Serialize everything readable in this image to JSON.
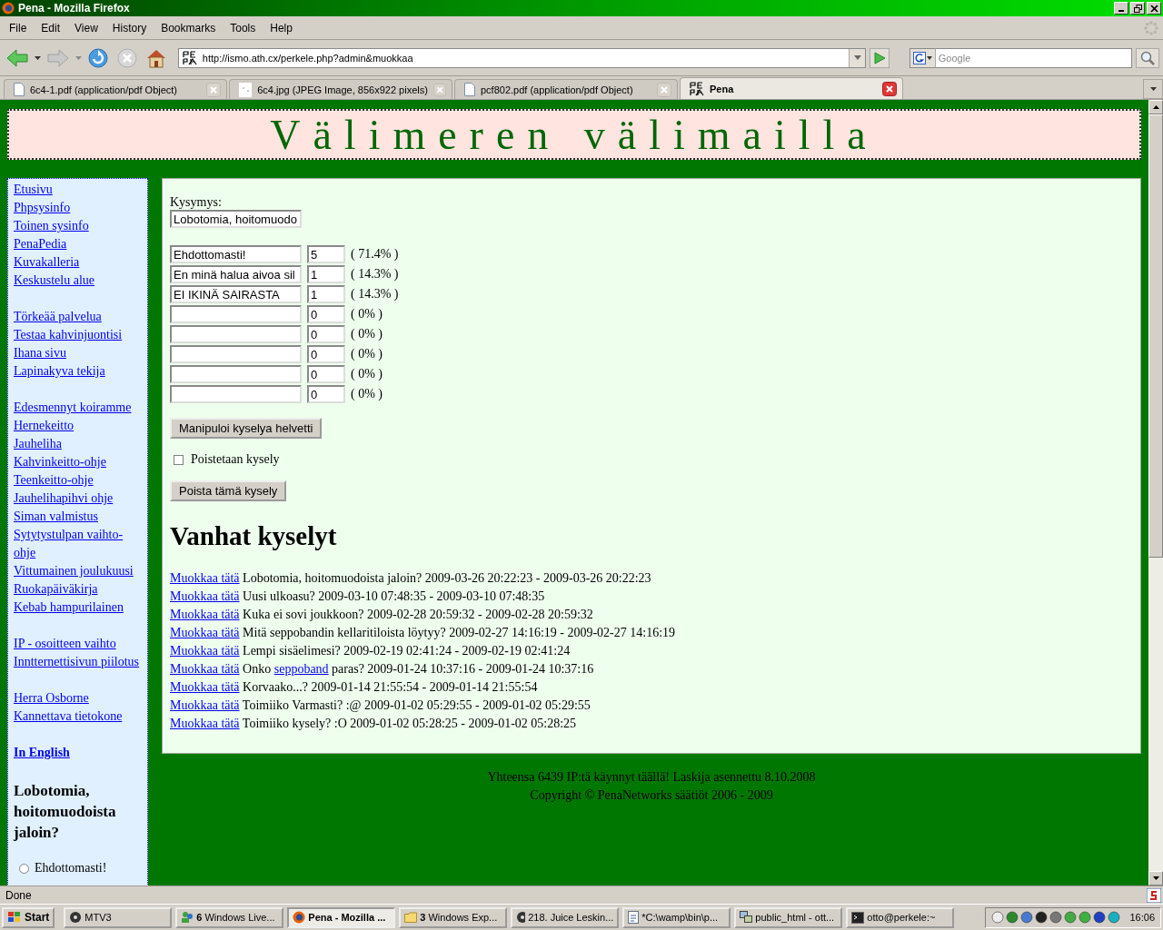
{
  "window": {
    "title": "Pena - Mozilla Firefox"
  },
  "menu": [
    "File",
    "Edit",
    "View",
    "History",
    "Bookmarks",
    "Tools",
    "Help"
  ],
  "address": {
    "url": "http://ismo.ath.cx/perkele.php?admin&muokkaa"
  },
  "search": {
    "placeholder": "Google"
  },
  "tabs": [
    {
      "label": "6c4-1.pdf (application/pdf Object)",
      "selected": false,
      "kind": "document"
    },
    {
      "label": "6c4.jpg (JPEG Image, 856x922 pixels)",
      "selected": false,
      "kind": "image"
    },
    {
      "label": "pcf802.pdf (application/pdf Object)",
      "selected": false,
      "kind": "document"
    },
    {
      "label": "Pena",
      "selected": true,
      "kind": "site"
    }
  ],
  "page": {
    "site_title": "Välimeren välimailla",
    "sidebar": {
      "link_groups": [
        [
          "Etusivu",
          "Phpsysinfo",
          "Toinen sysinfo",
          "PenaPedia",
          "Kuvakalleria",
          "Keskustelu alue"
        ],
        [
          "Törkeää palvelua",
          "Testaa kahvinjuontisi",
          "Ihana sivu",
          "Lapinakyva tekija"
        ],
        [
          "Edesmennyt koiramme",
          "Hernekeitto",
          "Jauheliha",
          "Kahvinkeitto-ohje",
          "Teenkeitto-ohje",
          "Jauhelihapihvi ohje",
          "Siman valmistus",
          "Sytytystulpan vaihto-ohje",
          "Vittumainen joulukuusi",
          "Ruokapäiväkirja",
          "Kebab hampurilainen"
        ],
        [
          "IP - osoitteen vaihto",
          "Inntternettisivun piilotus"
        ],
        [
          "Herra Osborne",
          "Kannettava tietokone"
        ]
      ],
      "english_link": "In English",
      "poll": {
        "question": "Lobotomia, hoitomuodoista jaloin?",
        "options": [
          {
            "label": "Ehdottomasti!",
            "selected": false
          }
        ]
      }
    },
    "editor": {
      "question_label": "Kysymys:",
      "question_value": "Lobotomia, hoitomuodo",
      "answers": [
        {
          "text": "Ehdottomasti!",
          "votes": "5",
          "share": "( 71.4% )"
        },
        {
          "text": "En minä halua aivoa sil",
          "votes": "1",
          "share": "( 14.3% )"
        },
        {
          "text": "EI IKINÄ SAIRASTA",
          "votes": "1",
          "share": "( 14.3% )"
        },
        {
          "votes": "0",
          "share": "( 0% )"
        },
        {
          "votes": "0",
          "share": "( 0% )"
        },
        {
          "votes": "0",
          "share": "( 0% )"
        },
        {
          "votes": "0",
          "share": "( 0% )"
        },
        {
          "votes": "0",
          "share": "( 0% )"
        }
      ],
      "submit": "Manipuloi kyselya helvetti",
      "delete_check": {
        "label": "Poistetaan kysely",
        "checked": false
      },
      "delete_button": "Poista tämä kysely",
      "old_heading": "Vanhat kyselyt",
      "old_polls": [
        {
          "link": "Muokkaa tätä",
          "parts": [
            {
              "kind": "text",
              "text": "Lobotomia, hoitomuodoista jaloin? 2009-03-26 20:22:23 - 2009-03-26 20:22:23"
            }
          ]
        },
        {
          "link": "Muokkaa tätä",
          "parts": [
            {
              "kind": "text",
              "text": "Uusi ulkoasu? 2009-03-10 07:48:35 - 2009-03-10 07:48:35"
            }
          ]
        },
        {
          "link": "Muokkaa tätä",
          "parts": [
            {
              "kind": "text",
              "text": "Kuka ei sovi joukkoon? 2009-02-28 20:59:32 - 2009-02-28 20:59:32"
            }
          ]
        },
        {
          "link": "Muokkaa tätä",
          "parts": [
            {
              "kind": "text",
              "text": "Mitä seppobandin kellaritiloista löytyy? 2009-02-27 14:16:19 - 2009-02-27 14:16:19"
            }
          ]
        },
        {
          "link": "Muokkaa tätä",
          "parts": [
            {
              "kind": "text",
              "text": "Lempi sisäelimesi? 2009-02-19 02:41:24 - 2009-02-19 02:41:24"
            }
          ]
        },
        {
          "link": "Muokkaa tätä",
          "parts": [
            {
              "kind": "text",
              "text": "Onko"
            },
            {
              "kind": "link",
              "text": "seppoband"
            },
            {
              "kind": "text",
              "text": "paras? 2009-01-24 10:37:16 - 2009-01-24 10:37:16"
            }
          ]
        },
        {
          "link": "Muokkaa tätä",
          "parts": [
            {
              "kind": "text",
              "text": "Korvaako...? 2009-01-14 21:55:54 - 2009-01-14 21:55:54"
            }
          ]
        },
        {
          "link": "Muokkaa tätä",
          "parts": [
            {
              "kind": "text",
              "text": "Toimiiko Varmasti? :@ 2009-01-02 05:29:55 - 2009-01-02 05:29:55"
            }
          ]
        },
        {
          "link": "Muokkaa tätä",
          "parts": [
            {
              "kind": "text",
              "text": "Toimiiko kysely? :O 2009-01-02 05:28:25 - 2009-01-02 05:28:25"
            }
          ]
        }
      ]
    },
    "footer": [
      "Yhteensa 6439 IP:tä käynnyt täällä! Laskija asennettu 8.10.2008",
      "Copyright © PenaNetworks säätiöt 2006 - 2009"
    ]
  },
  "status_bar": "Done",
  "taskbar": {
    "start": "Start",
    "items": [
      {
        "label": "MTV3",
        "selected": false,
        "kind": "media"
      },
      {
        "label": "Windows Live...",
        "count": "6",
        "selected": false,
        "kind": "people"
      },
      {
        "label": "Pena - Mozilla ...",
        "selected": true,
        "kind": "browser"
      },
      {
        "label": "Windows Exp...",
        "count": "3",
        "selected": false,
        "kind": "folder"
      },
      {
        "label": "218. Juice Leskin...",
        "selected": false,
        "kind": "media"
      },
      {
        "label": "*C:\\wamp\\bin\\p...",
        "selected": false,
        "kind": "editor"
      },
      {
        "label": "public_html - ott...",
        "selected": false,
        "kind": "network"
      },
      {
        "label": "otto@perkele:~",
        "selected": false,
        "kind": "terminal"
      }
    ],
    "clock": "16:06"
  }
}
